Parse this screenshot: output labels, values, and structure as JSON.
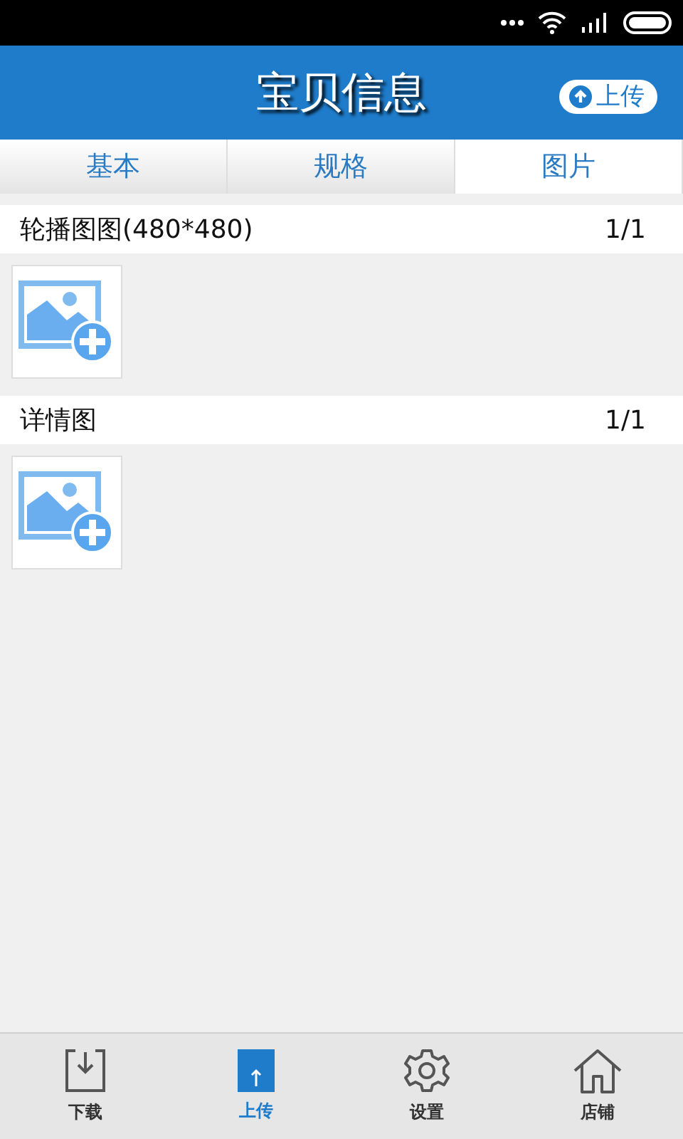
{
  "header": {
    "title": "宝贝信息",
    "upload_button": "上传"
  },
  "tabs": [
    {
      "label": "基本",
      "selected": false
    },
    {
      "label": "规格",
      "selected": false
    },
    {
      "label": "图片",
      "selected": true
    }
  ],
  "sections": [
    {
      "title": "轮播图图(480*480)",
      "count": "1/1"
    },
    {
      "title": "详情图",
      "count": "1/1"
    }
  ],
  "bottom_nav": [
    {
      "kind": "download",
      "label": "下载",
      "selected": false
    },
    {
      "kind": "upload",
      "label": "上传",
      "selected": true
    },
    {
      "kind": "settings",
      "label": "设置",
      "selected": false
    },
    {
      "kind": "store",
      "label": "店铺",
      "selected": false
    }
  ]
}
